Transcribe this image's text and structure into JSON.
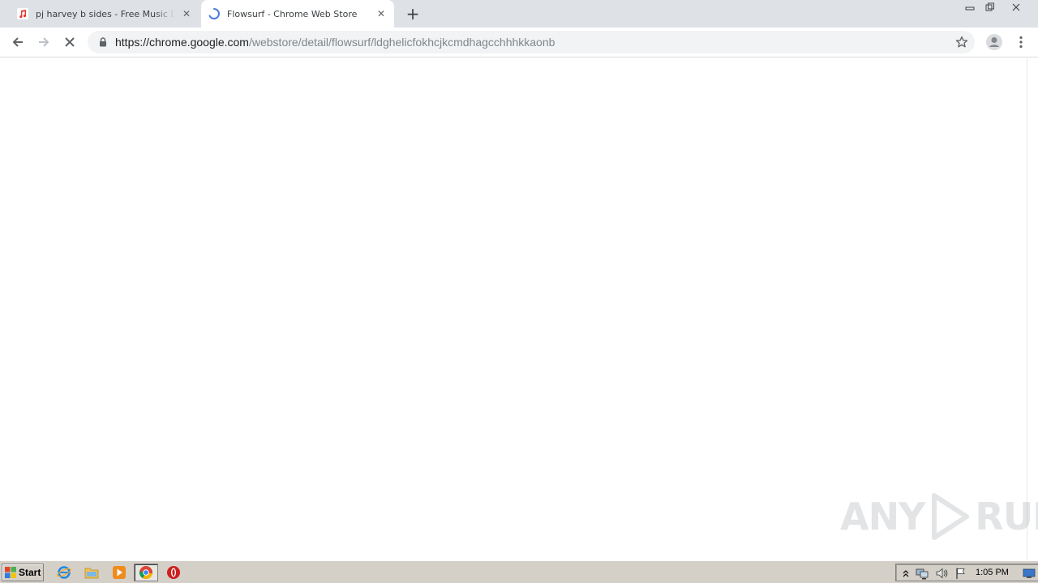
{
  "browser": {
    "tabs": [
      {
        "title": "pj harvey b sides - Free Music Downl",
        "favicon": "music-note-icon",
        "active": false
      },
      {
        "title": "Flowsurf - Chrome Web Store",
        "favicon": "loading-spinner-icon",
        "active": true
      }
    ],
    "url": {
      "scheme_host": "https://chrome.google.com",
      "path": "/webstore/detail/flowsurf/ldghelicfokhcjkcmdhagcchhhkkaonb"
    },
    "loading": true
  },
  "watermark": {
    "text_left": "ANY",
    "text_right": "RUN"
  },
  "taskbar": {
    "start_label": "Start",
    "clock": "1:05 PM",
    "apps": [
      "internet-explorer-icon",
      "folder-icon",
      "media-player-icon",
      "chrome-icon",
      "opera-icon"
    ]
  },
  "colors": {
    "tabstrip": "#dee1e6",
    "omnibox": "#f1f3f4",
    "taskbar": "#d4d0c8",
    "spinner": "#4a7bdc",
    "music_icon": "#e53935"
  }
}
